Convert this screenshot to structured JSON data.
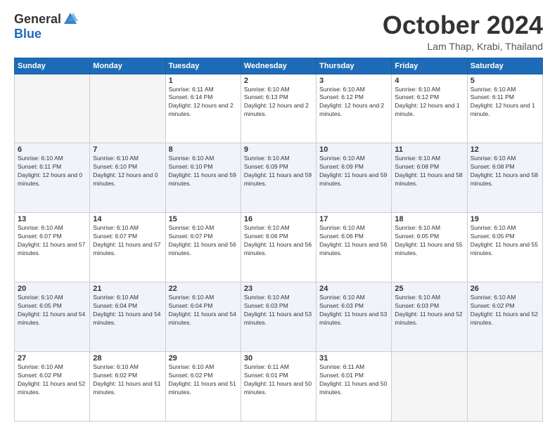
{
  "header": {
    "logo": {
      "general": "General",
      "blue": "Blue"
    },
    "title": "October 2024",
    "location": "Lam Thap, Krabi, Thailand"
  },
  "calendar": {
    "days_of_week": [
      "Sunday",
      "Monday",
      "Tuesday",
      "Wednesday",
      "Thursday",
      "Friday",
      "Saturday"
    ],
    "weeks": [
      {
        "shaded": false,
        "days": [
          {
            "num": "",
            "empty": true
          },
          {
            "num": "",
            "empty": true
          },
          {
            "num": "1",
            "sunrise": "6:11 AM",
            "sunset": "6:14 PM",
            "daylight": "12 hours and 2 minutes."
          },
          {
            "num": "2",
            "sunrise": "6:10 AM",
            "sunset": "6:13 PM",
            "daylight": "12 hours and 2 minutes."
          },
          {
            "num": "3",
            "sunrise": "6:10 AM",
            "sunset": "6:12 PM",
            "daylight": "12 hours and 2 minutes."
          },
          {
            "num": "4",
            "sunrise": "6:10 AM",
            "sunset": "6:12 PM",
            "daylight": "12 hours and 1 minute."
          },
          {
            "num": "5",
            "sunrise": "6:10 AM",
            "sunset": "6:11 PM",
            "daylight": "12 hours and 1 minute."
          }
        ]
      },
      {
        "shaded": true,
        "days": [
          {
            "num": "6",
            "sunrise": "6:10 AM",
            "sunset": "6:11 PM",
            "daylight": "12 hours and 0 minutes."
          },
          {
            "num": "7",
            "sunrise": "6:10 AM",
            "sunset": "6:10 PM",
            "daylight": "12 hours and 0 minutes."
          },
          {
            "num": "8",
            "sunrise": "6:10 AM",
            "sunset": "6:10 PM",
            "daylight": "11 hours and 59 minutes."
          },
          {
            "num": "9",
            "sunrise": "6:10 AM",
            "sunset": "6:09 PM",
            "daylight": "11 hours and 59 minutes."
          },
          {
            "num": "10",
            "sunrise": "6:10 AM",
            "sunset": "6:09 PM",
            "daylight": "11 hours and 59 minutes."
          },
          {
            "num": "11",
            "sunrise": "6:10 AM",
            "sunset": "6:08 PM",
            "daylight": "11 hours and 58 minutes."
          },
          {
            "num": "12",
            "sunrise": "6:10 AM",
            "sunset": "6:08 PM",
            "daylight": "11 hours and 58 minutes."
          }
        ]
      },
      {
        "shaded": false,
        "days": [
          {
            "num": "13",
            "sunrise": "6:10 AM",
            "sunset": "6:07 PM",
            "daylight": "11 hours and 57 minutes."
          },
          {
            "num": "14",
            "sunrise": "6:10 AM",
            "sunset": "6:07 PM",
            "daylight": "11 hours and 57 minutes."
          },
          {
            "num": "15",
            "sunrise": "6:10 AM",
            "sunset": "6:07 PM",
            "daylight": "11 hours and 56 minutes."
          },
          {
            "num": "16",
            "sunrise": "6:10 AM",
            "sunset": "6:06 PM",
            "daylight": "11 hours and 56 minutes."
          },
          {
            "num": "17",
            "sunrise": "6:10 AM",
            "sunset": "6:06 PM",
            "daylight": "11 hours and 56 minutes."
          },
          {
            "num": "18",
            "sunrise": "6:10 AM",
            "sunset": "6:05 PM",
            "daylight": "11 hours and 55 minutes."
          },
          {
            "num": "19",
            "sunrise": "6:10 AM",
            "sunset": "6:05 PM",
            "daylight": "11 hours and 55 minutes."
          }
        ]
      },
      {
        "shaded": true,
        "days": [
          {
            "num": "20",
            "sunrise": "6:10 AM",
            "sunset": "6:05 PM",
            "daylight": "11 hours and 54 minutes."
          },
          {
            "num": "21",
            "sunrise": "6:10 AM",
            "sunset": "6:04 PM",
            "daylight": "11 hours and 54 minutes."
          },
          {
            "num": "22",
            "sunrise": "6:10 AM",
            "sunset": "6:04 PM",
            "daylight": "11 hours and 54 minutes."
          },
          {
            "num": "23",
            "sunrise": "6:10 AM",
            "sunset": "6:03 PM",
            "daylight": "11 hours and 53 minutes."
          },
          {
            "num": "24",
            "sunrise": "6:10 AM",
            "sunset": "6:03 PM",
            "daylight": "11 hours and 53 minutes."
          },
          {
            "num": "25",
            "sunrise": "6:10 AM",
            "sunset": "6:03 PM",
            "daylight": "11 hours and 52 minutes."
          },
          {
            "num": "26",
            "sunrise": "6:10 AM",
            "sunset": "6:02 PM",
            "daylight": "11 hours and 52 minutes."
          }
        ]
      },
      {
        "shaded": false,
        "days": [
          {
            "num": "27",
            "sunrise": "6:10 AM",
            "sunset": "6:02 PM",
            "daylight": "11 hours and 52 minutes."
          },
          {
            "num": "28",
            "sunrise": "6:10 AM",
            "sunset": "6:02 PM",
            "daylight": "11 hours and 51 minutes."
          },
          {
            "num": "29",
            "sunrise": "6:10 AM",
            "sunset": "6:02 PM",
            "daylight": "11 hours and 51 minutes."
          },
          {
            "num": "30",
            "sunrise": "6:11 AM",
            "sunset": "6:01 PM",
            "daylight": "11 hours and 50 minutes."
          },
          {
            "num": "31",
            "sunrise": "6:11 AM",
            "sunset": "6:01 PM",
            "daylight": "11 hours and 50 minutes."
          },
          {
            "num": "",
            "empty": true
          },
          {
            "num": "",
            "empty": true
          }
        ]
      }
    ]
  }
}
